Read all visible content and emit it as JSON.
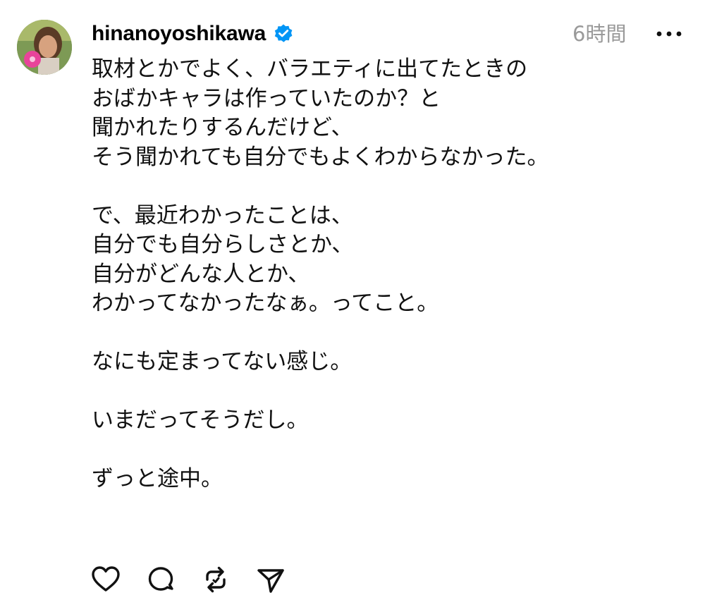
{
  "post": {
    "username": "hinanoyoshikawa",
    "verified": true,
    "timestamp": "6時間",
    "body": "取材とかでよく、バラエティに出てたときの\nおばかキャラは作っていたのか？と\n聞かれたりするんだけど、\nそう聞かれても自分でもよくわからなかった。\n\nで、最近わかったことは、\n自分でも自分らしさとか、\n自分がどんな人とか、\nわかってなかったなぁ。ってこと。\n\nなにも定まってない感じ。\n\nいまだってそうだし。\n\nずっと途中。"
  },
  "icons": {
    "verified": "verified-badge-icon",
    "more": "more-icon",
    "like": "heart-icon",
    "comment": "comment-icon",
    "repost": "repost-icon",
    "share": "share-icon"
  },
  "colors": {
    "verified_blue": "#0095f6",
    "timestamp_gray": "#9a9a9a",
    "text": "#111111"
  }
}
